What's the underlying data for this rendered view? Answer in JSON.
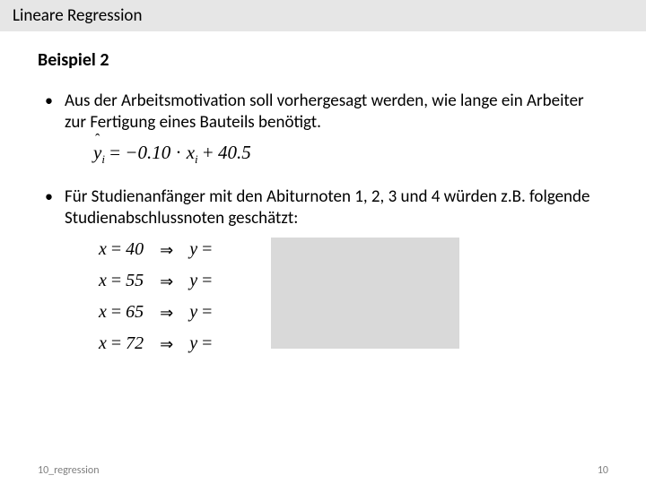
{
  "header": {
    "title": "Lineare Regression"
  },
  "subheading": "Beispiel 2",
  "bullets": {
    "b1": "Aus der Arbeitsmotivation soll vorhergesagt werden, wie lange ein Arbeiter zur Fertigung eines Bauteils benötigt.",
    "b2": "Für Studienanfänger mit den Abiturnoten 1, 2, 3 und 4 würden z.B. folgende Studienabschlussnoten geschätzt:"
  },
  "equation": {
    "lhs_var": "y",
    "lhs_sub": "i",
    "slope": "−0.10",
    "xvar": "x",
    "xsub": "i",
    "intercept": "40.5"
  },
  "examples": [
    {
      "x": "40",
      "yhat": ""
    },
    {
      "x": "55",
      "yhat": ""
    },
    {
      "x": "65",
      "yhat": ""
    },
    {
      "x": "72",
      "yhat": ""
    }
  ],
  "labels": {
    "x": "x",
    "eq": "=",
    "implies": "⇒",
    "yhat": "y"
  },
  "footer": {
    "left": "10_regression",
    "right": "10"
  }
}
